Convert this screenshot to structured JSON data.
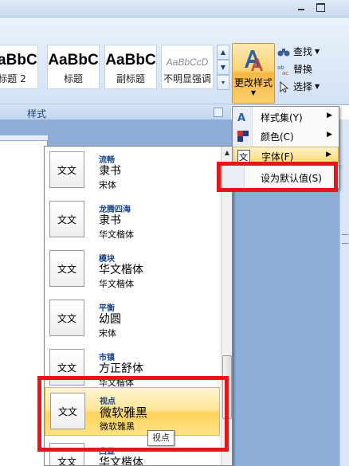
{
  "ribbon": {
    "style_gallery": [
      {
        "sample": "AaBbC",
        "name": "标题 2"
      },
      {
        "sample": "AaBbC",
        "name": "标题"
      },
      {
        "sample": "AaBbC",
        "name": "副标题"
      },
      {
        "sample": "AaBbCcD",
        "name": "不明显强调"
      }
    ],
    "change_style_label": "更改样式",
    "group_label": "样式",
    "editing": {
      "find": "查找",
      "replace": "替换",
      "select": "选择"
    }
  },
  "menu": {
    "items": [
      {
        "label": "样式集(Y)",
        "icon": "style-set-icon"
      },
      {
        "label": "颜色(C)",
        "icon": "color-icon"
      },
      {
        "label": "字体(F)",
        "icon": "font-icon"
      }
    ],
    "submenu_label": "设为默认值(S)"
  },
  "font_panel": {
    "thumb_text": "文文",
    "items": [
      {
        "theme": "流畅",
        "heading": "隶书",
        "body": "宋体"
      },
      {
        "theme": "龙腾四海",
        "heading": "隶书",
        "body": "华文楷体"
      },
      {
        "theme": "模块",
        "heading": "华文楷体",
        "body": "华文楷体"
      },
      {
        "theme": "平衡",
        "heading": "幼圆",
        "body": "宋体"
      },
      {
        "theme": "市镇",
        "heading": "方正舒体",
        "body": "华文楷体"
      },
      {
        "theme": "视点",
        "heading": "微软雅黑",
        "body": "微软雅黑",
        "selected": true
      },
      {
        "theme": "凸显",
        "heading": "华文楷体",
        "body": ""
      }
    ],
    "tooltip": "视点"
  },
  "colors": {
    "highlight_red": "#e8141c",
    "selected_gold": "#ffd35c",
    "ribbon_blue": "#dce8f7"
  }
}
